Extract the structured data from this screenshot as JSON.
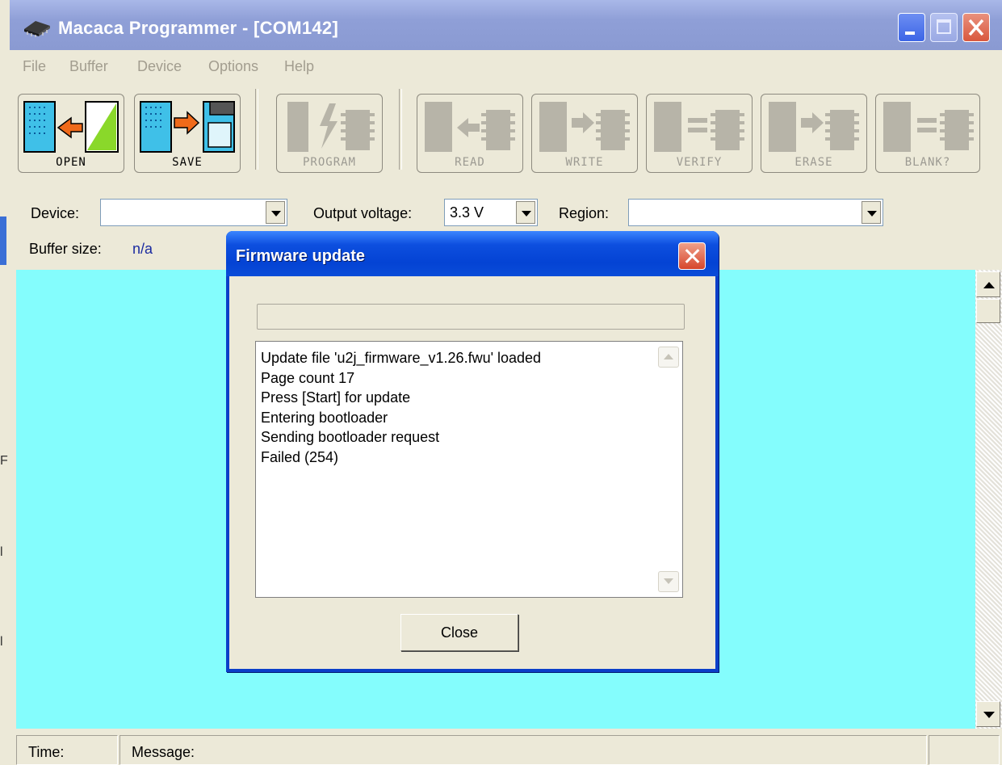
{
  "window": {
    "title": "Macaca Programmer - [COM142]"
  },
  "menu": [
    "File",
    "Buffer",
    "Device",
    "Options",
    "Help"
  ],
  "toolbar": {
    "open": "OPEN",
    "save": "SAVE",
    "program": "PROGRAM",
    "read": "READ",
    "write": "WRITE",
    "verify": "VERIFY",
    "erase": "ERASE",
    "blank": "BLANK?"
  },
  "fields": {
    "device_label": "Device:",
    "device_value": "",
    "voltage_label": "Output voltage:",
    "voltage_value": "3.3 V",
    "region_label": "Region:",
    "region_value": "",
    "buffer_label": "Buffer size:",
    "buffer_value": "n/a"
  },
  "status": {
    "time_label": "Time:",
    "message_label": "Message:"
  },
  "dialog": {
    "title": "Firmware update",
    "progress": 0,
    "log": [
      "Update file 'u2j_firmware_v1.26.fwu' loaded",
      "Page count 17",
      "Press [Start] for update",
      "Entering bootloader",
      "Sending bootloader request",
      "Failed (254)"
    ],
    "close_label": "Close"
  },
  "colors": {
    "canvas": "#84fdfd",
    "dialog_title": "#0443d4",
    "window_title": "#8f9fd7"
  },
  "left_strip_glyphs": [
    "F",
    "l",
    "l"
  ]
}
